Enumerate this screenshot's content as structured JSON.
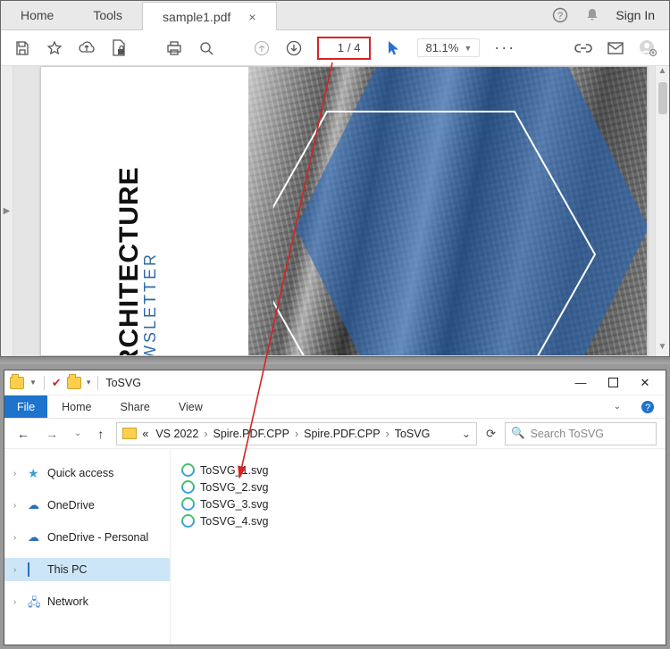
{
  "pdf": {
    "tabs": {
      "home": "Home",
      "tools": "Tools"
    },
    "doc_tab": "sample1.pdf",
    "signin": "Sign In",
    "page_current": "1",
    "page_total": "4",
    "zoom": "81.1%",
    "doc_title": "ARCHITECTURE",
    "doc_subtitle": "NEWSLETTER"
  },
  "explorer": {
    "window_title": "ToSVG",
    "ribbon": {
      "file": "File",
      "home": "Home",
      "share": "Share",
      "view": "View"
    },
    "breadcrumb": [
      "VS 2022",
      "Spire.PDF.CPP",
      "Spire.PDF.CPP",
      "ToSVG"
    ],
    "breadcrumb_prefix": "«",
    "search_placeholder": "Search ToSVG",
    "nav": {
      "quick": "Quick access",
      "onedrive": "OneDrive",
      "onedrive_personal": "OneDrive - Personal",
      "thispc": "This PC",
      "network": "Network"
    },
    "files": [
      "ToSVG_1.svg",
      "ToSVG_2.svg",
      "ToSVG_3.svg",
      "ToSVG_4.svg"
    ]
  }
}
